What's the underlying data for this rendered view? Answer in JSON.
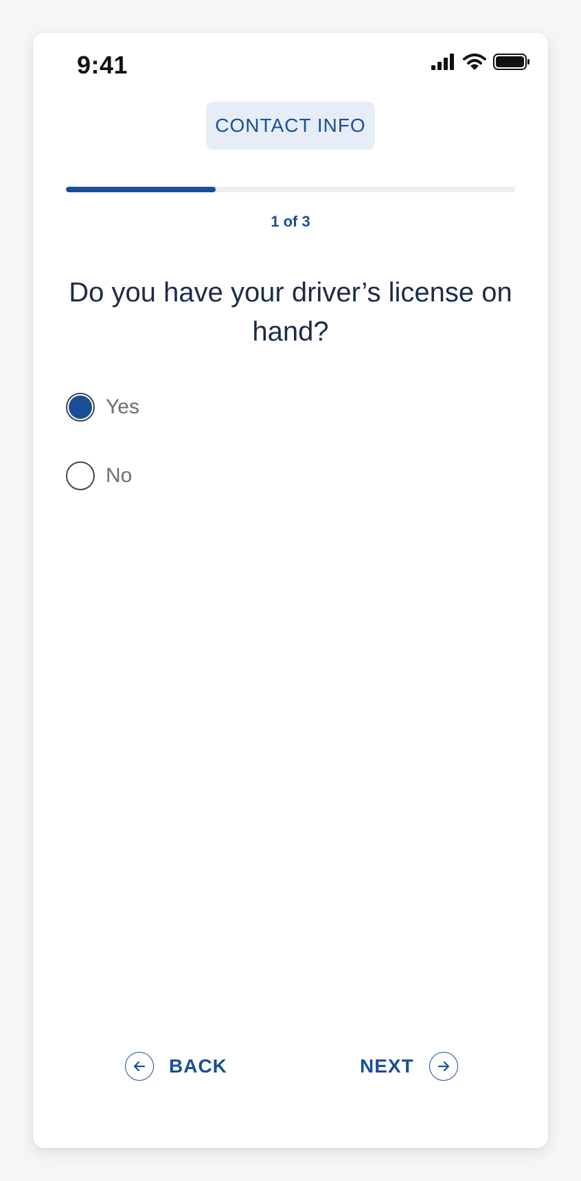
{
  "status_bar": {
    "time": "9:41",
    "icons": [
      "signal-icon",
      "wifi-icon",
      "battery-icon"
    ]
  },
  "header": {
    "section_label": "CONTACT INFO"
  },
  "progress": {
    "current_step": 1,
    "total_steps": 3,
    "fraction": 0.333,
    "label": "1 of 3"
  },
  "question": {
    "text": "Do you have your driver’s license on hand?",
    "options": [
      {
        "label": "Yes",
        "selected": true
      },
      {
        "label": "No",
        "selected": false
      }
    ]
  },
  "navigation": {
    "back_label": "BACK",
    "back_icon": "arrow-left-circle-icon",
    "next_label": "NEXT",
    "next_icon": "arrow-right-circle-icon"
  },
  "colors": {
    "accent": "#1a4e96",
    "chip_background": "#e7edf6",
    "heading": "#1a2b4a",
    "option_text": "#6d6d72"
  }
}
